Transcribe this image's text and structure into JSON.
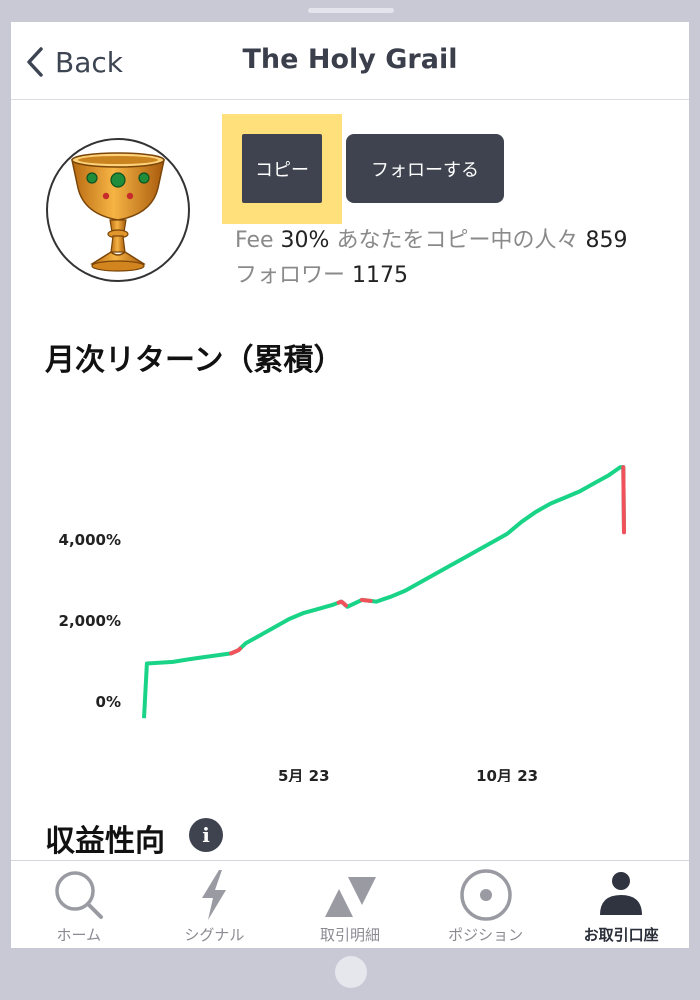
{
  "header": {
    "back_label": "Back",
    "title": "The Holy Grail"
  },
  "profile": {
    "copy_label": "コピー",
    "follow_label": "フォローする",
    "fee_label": "Fee",
    "fee_value": "30%",
    "copiers_label": "あなたをコピー中の人々",
    "copiers_value": "859",
    "followers_label": "フォロワー",
    "followers_value": "1175"
  },
  "chart_section_title": "月次リターン（累積）",
  "chart_data": {
    "type": "line",
    "y_unit": "%",
    "x_tick_labels": [
      "5月 23",
      "10月 23"
    ],
    "y_tick_labels": [
      "0%",
      "2,000%",
      "4,000%"
    ],
    "y_ticks": [
      0,
      2000,
      4000
    ],
    "colors": {
      "up": "#19d487",
      "down": "#f0515a"
    },
    "series": [
      {
        "points": [
          [
            0,
            -400
          ],
          [
            0.2,
            950
          ],
          [
            2,
            990
          ],
          [
            3,
            1050
          ],
          [
            4,
            1100
          ],
          [
            5,
            1150
          ],
          [
            6,
            1200
          ],
          [
            6.5,
            1280
          ],
          [
            7,
            1450
          ],
          [
            8,
            1650
          ],
          [
            9,
            1850
          ],
          [
            10,
            2050
          ],
          [
            11,
            2200
          ],
          [
            12,
            2300
          ],
          [
            13,
            2400
          ],
          [
            13.6,
            2480
          ],
          [
            14,
            2350
          ],
          [
            15,
            2520
          ],
          [
            16,
            2480
          ],
          [
            17,
            2600
          ],
          [
            18,
            2750
          ],
          [
            19,
            2950
          ],
          [
            20,
            3150
          ],
          [
            21,
            3350
          ],
          [
            22,
            3550
          ],
          [
            23,
            3750
          ],
          [
            24,
            3950
          ],
          [
            25,
            4150
          ],
          [
            26,
            4450
          ],
          [
            27,
            4700
          ],
          [
            28,
            4900
          ],
          [
            29,
            5050
          ],
          [
            30,
            5200
          ],
          [
            31,
            5400
          ],
          [
            32,
            5600
          ],
          [
            32.8,
            5800
          ],
          [
            33,
            5800
          ],
          [
            33.05,
            4190
          ]
        ]
      }
    ],
    "down_segments": [
      {
        "from": 6.0,
        "to": 6.6
      },
      {
        "from": 13.4,
        "to": 13.9
      },
      {
        "from": 15.0,
        "to": 15.6
      },
      {
        "from": 33.0,
        "to": 33.05
      }
    ],
    "x_ticks": [
      11,
      25
    ]
  },
  "strategy_section_title": "収益性向",
  "info_glyph": "i",
  "tabs": [
    {
      "label": "ホーム",
      "icon": "search-icon",
      "active": false
    },
    {
      "label": "シグナル",
      "icon": "lightning-icon",
      "active": false
    },
    {
      "label": "取引明細",
      "icon": "trades-icon",
      "active": false
    },
    {
      "label": "ポジション",
      "icon": "position-icon",
      "active": false
    },
    {
      "label": "お取引口座",
      "icon": "account-icon",
      "active": true
    }
  ]
}
